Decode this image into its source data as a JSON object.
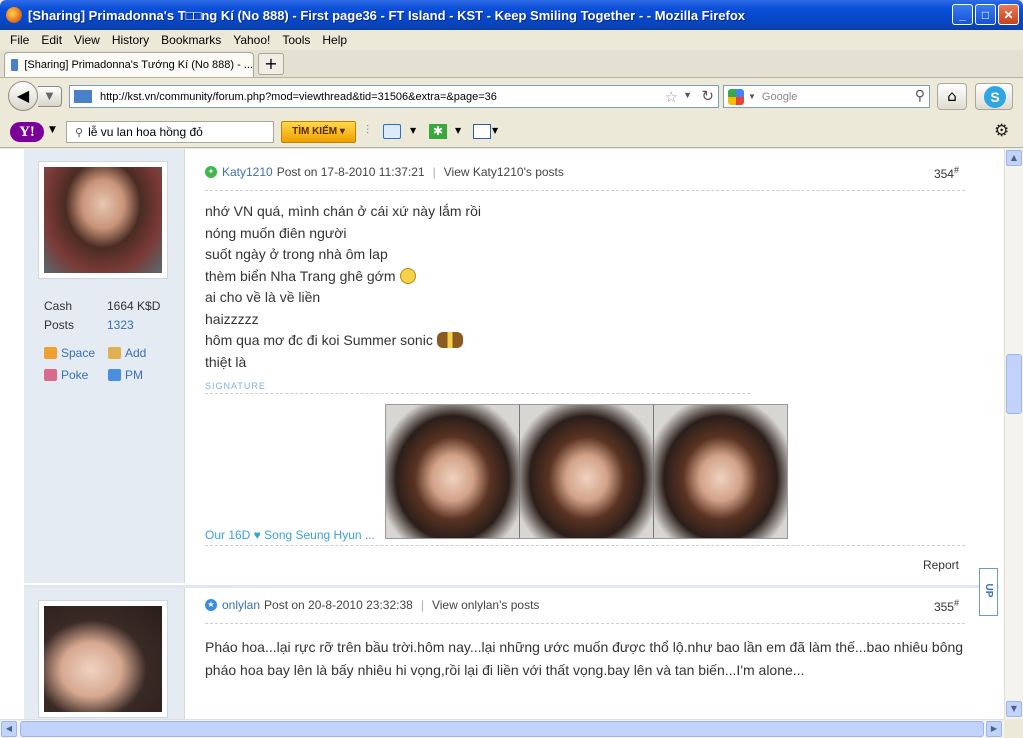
{
  "window": {
    "title": "[Sharing] Primadonna's T□□ng Kí (No 888) - First page36 - FT Island - KST - Keep Smiling Together - - Mozilla Firefox",
    "minimize": "_",
    "maximize": "□",
    "close": "✕"
  },
  "menu": [
    "File",
    "Edit",
    "View",
    "History",
    "Bookmarks",
    "Yahoo!",
    "Tools",
    "Help"
  ],
  "tab": {
    "label": "[Sharing] Primadonna's Tướng Kí (No 888) - ...",
    "new_tab": "+"
  },
  "nav": {
    "url": "http://kst.vn/community/forum.php?mod=viewthread&tid=31506&extra=&page=36",
    "search_placeholder": "Google"
  },
  "yahoo": {
    "logo": "Y!",
    "search_value": "lễ vu lan hoa hồng đỏ",
    "search_button": "TÌM KIẾM"
  },
  "posts": [
    {
      "author": "Katy1210",
      "posted": "Post on 17-8-2010 11:37:21",
      "view_posts": "View Katy1210's posts",
      "number": "354",
      "number_mark": "#",
      "stats": [
        {
          "k": "Cash",
          "v": "1664 K$D"
        },
        {
          "k": "Posts",
          "v": "1323"
        }
      ],
      "links": {
        "space": "Space",
        "add": "Add",
        "poke": "Poke",
        "pm": "PM"
      },
      "lines": [
        "nhớ VN quá, mình chán ở cái xứ này lắm rồi",
        "nóng muốn điên người",
        "suốt ngày ở trong nhà ôm lap",
        "thèm biển Nha Trang ghê gớm",
        "ai cho về là về liền",
        "haizzzzz",
        "hôm qua mơ đc đi koi Summer sonic",
        "thiệt là"
      ],
      "signature_label": "SIGNATURE",
      "signature_text": "Our 16D ♥ Song Seung Hyun ...",
      "report": "Report"
    },
    {
      "author": "onlylan",
      "posted": "Post on 20-8-2010 23:32:38",
      "view_posts": "View onlylan's posts",
      "number": "355",
      "number_mark": "#",
      "lines": [
        "Pháo hoa...lại rực rỡ trên bầu trời.hôm nay...lại những ước muốn được thổ lộ.như bao lần em đã làm thế...bao nhiêu bông",
        "pháo hoa bay lên là bấy nhiêu hi vọng,rồi lại đi liền với thất vọng.bay lên và tan biến...I'm alone..."
      ]
    }
  ],
  "up_button": "UP"
}
